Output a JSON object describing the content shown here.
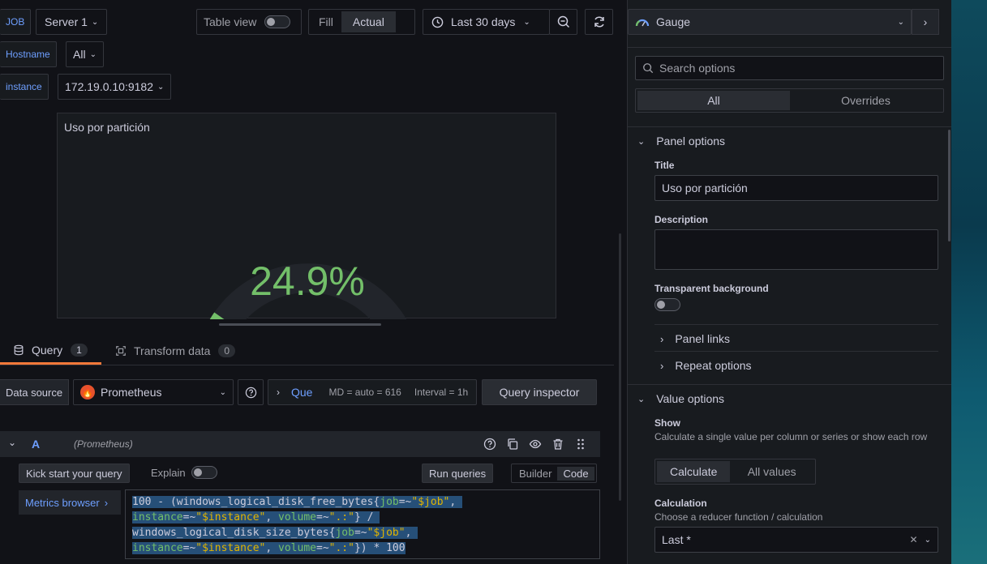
{
  "vars": {
    "job": {
      "label": "JOB",
      "value": "Server 1"
    },
    "hostname": {
      "label": "Hostname",
      "value": "All"
    },
    "instance": {
      "label": "instance",
      "value": "172.19.0.10:9182"
    }
  },
  "toolbar": {
    "table_view": "Table view",
    "fill": "Fill",
    "actual": "Actual",
    "time_range": "Last 30 days"
  },
  "panel": {
    "title": "Uso por partición",
    "value": "24.9%",
    "gauge_fraction": 0.249,
    "color": "#73bf69"
  },
  "tabs": {
    "query": {
      "label": "Query",
      "count": "1"
    },
    "transform": {
      "label": "Transform data",
      "count": "0"
    }
  },
  "datasource": {
    "label": "Data source",
    "name": "Prometheus",
    "query_options_label": "Que",
    "md": "MD = auto = 616",
    "interval": "Interval = 1h",
    "inspector": "Query inspector"
  },
  "query_row": {
    "ref": "A",
    "source": "(Prometheus)",
    "kick_start": "Kick start your query",
    "explain": "Explain",
    "run": "Run queries",
    "builder": "Builder",
    "code": "Code",
    "metrics_browser": "Metrics browser",
    "lines": {
      "l1a": "100 - (windows_logical_disk_free_bytes{",
      "l1b": "job",
      "l1c": "=~",
      "l1d": "\"$job\"",
      "l1e": ",",
      "l2a": "instance",
      "l2b": "=~",
      "l2c": "\"$instance\"",
      "l2d": ", ",
      "l2e": "volume",
      "l2f": "=~",
      "l2g": "\".:\"",
      "l2h": "} /",
      "l3a": "windows_logical_disk_size_bytes{",
      "l3b": "job",
      "l3c": "=~",
      "l3d": "\"$job\"",
      "l3e": ",",
      "l4a": "instance",
      "l4b": "=~",
      "l4c": "\"$instance\"",
      "l4d": ", ",
      "l4e": "volume",
      "l4f": "=~",
      "l4g": "\".:\"",
      "l4h": "}) * 100"
    }
  },
  "options": {
    "viz": "Gauge",
    "search_placeholder": "Search options",
    "tab_all": "All",
    "tab_overrides": "Overrides",
    "panel_options": "Panel options",
    "title_label": "Title",
    "title_value": "Uso por partición",
    "description_label": "Description",
    "transparent_label": "Transparent background",
    "panel_links": "Panel links",
    "repeat_options": "Repeat options",
    "value_options": "Value options",
    "show_label": "Show",
    "show_desc": "Calculate a single value per column or series or show each row",
    "calculate": "Calculate",
    "all_values": "All values",
    "calculation_label": "Calculation",
    "calculation_desc": "Choose a reducer function / calculation",
    "calculation_value": "Last *"
  }
}
